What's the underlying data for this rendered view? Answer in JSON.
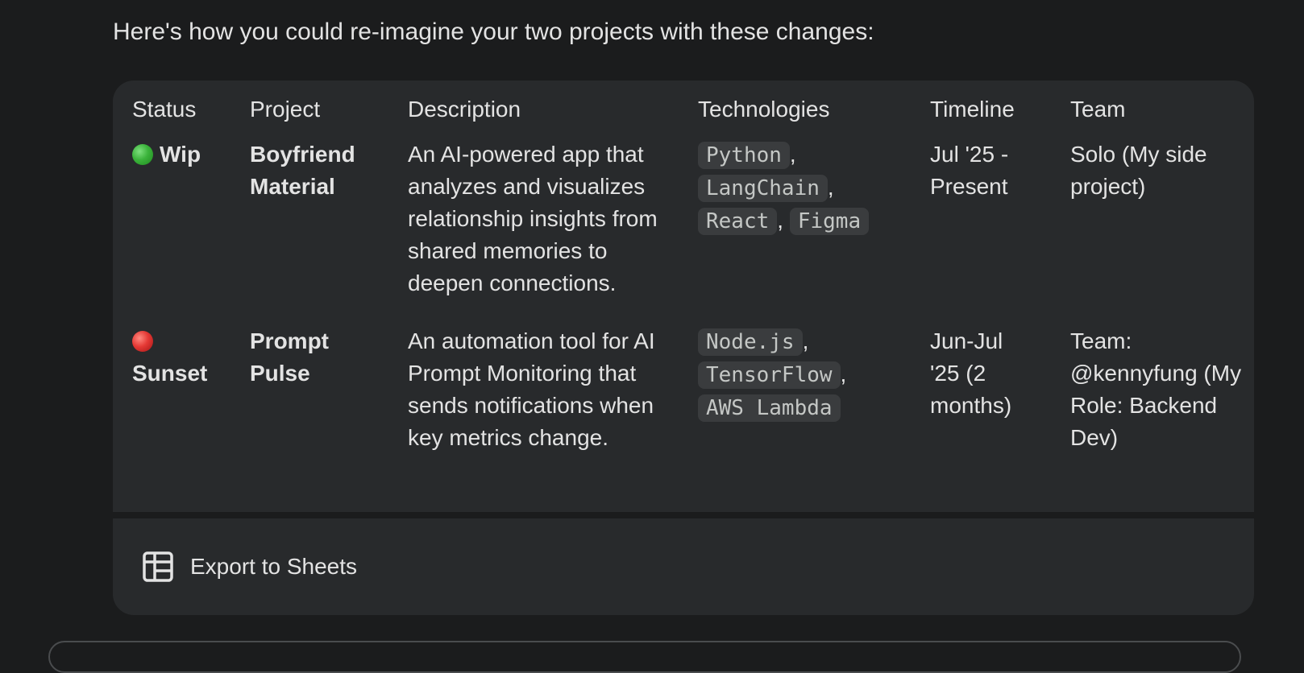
{
  "intro": "Here's how you could re-imagine your two projects with these changes:",
  "table": {
    "headers": [
      "Status",
      "Project",
      "Description",
      "Technologies",
      "Timeline",
      "Team"
    ],
    "rows": [
      {
        "status_icon": "green-circle-icon",
        "status": "Wip",
        "project": "Boyfriend Material",
        "description": "An AI-powered app that analyzes and visualizes relationship insights from shared memories to deepen connections.",
        "technologies": [
          "Python",
          "LangChain",
          "React",
          "Figma"
        ],
        "timeline": "Jul '25 - Present",
        "team": "Solo (My side project)"
      },
      {
        "status_icon": "red-circle-icon",
        "status": "Sunset",
        "project": "Prompt Pulse",
        "description": "An automation tool for AI Prompt Monitoring that sends notifications when key metrics change.",
        "technologies": [
          "Node.js",
          "TensorFlow",
          "AWS Lambda"
        ],
        "timeline": "Jun-Jul '25 (2 months)",
        "team": "Team: @kennyfung (My Role: Backend Dev)"
      }
    ]
  },
  "export": {
    "label": "Export to Sheets",
    "icon": "sheets-table-icon"
  },
  "colors": {
    "background": "#1b1c1d",
    "card": "#282a2c",
    "code_bg": "#3a3c3e",
    "text": "#e3e3e3"
  }
}
